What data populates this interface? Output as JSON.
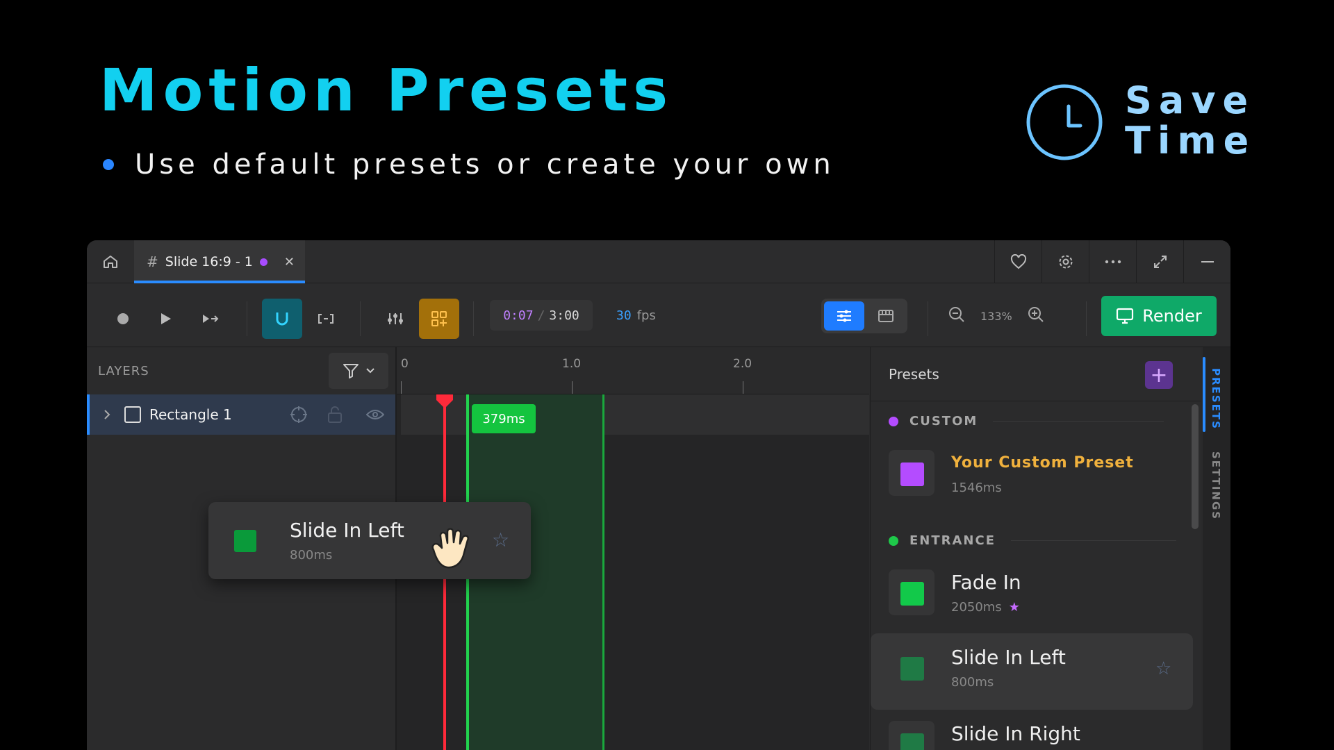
{
  "hero": {
    "title": "Motion Presets",
    "bullet": "Use default presets or create your own",
    "badge_line1": "Save",
    "badge_line2": "Time"
  },
  "titlebar": {
    "tab_label": "Slide 16:9 - 1",
    "right_buttons": [
      "heart-icon",
      "gear-icon",
      "more-icon",
      "expand-icon",
      "minimize-icon"
    ]
  },
  "toolbar": {
    "time_current": "0:07",
    "time_separator": "/",
    "time_total": "3:00",
    "fps_value": "30",
    "fps_label": "fps",
    "zoom": "133%",
    "render_label": "Render",
    "colors": {
      "snap": "#0f5f6e",
      "preset_toggle": "#a3700a",
      "render": "#0fa968",
      "accent": "#1f7cff"
    }
  },
  "layers": {
    "header": "LAYERS",
    "items": [
      {
        "name": "Rectangle 1"
      }
    ]
  },
  "timeline": {
    "ruler": [
      "0",
      "1.0",
      "2.0"
    ],
    "clip_label": "379ms"
  },
  "drag_card": {
    "name": "Slide In Left",
    "duration": "800ms"
  },
  "presets": {
    "title": "Presets",
    "sections": [
      {
        "label": "CUSTOM",
        "color": "#b44cff"
      },
      {
        "label": "ENTRANCE",
        "color": "#1ec94a"
      }
    ],
    "items": [
      {
        "name": "Your Custom Preset",
        "duration": "1546ms",
        "color": "#b44cff"
      },
      {
        "name": "Fade In",
        "duration": "2050ms",
        "color": "#12c94a",
        "starred": true
      },
      {
        "name": "Slide In Left",
        "duration": "800ms",
        "color": "#1f7a45"
      },
      {
        "name": "Slide In Right",
        "duration": "",
        "color": "#1f7a45"
      }
    ]
  },
  "side_tabs": [
    "PRESETS",
    "SETTINGS"
  ]
}
